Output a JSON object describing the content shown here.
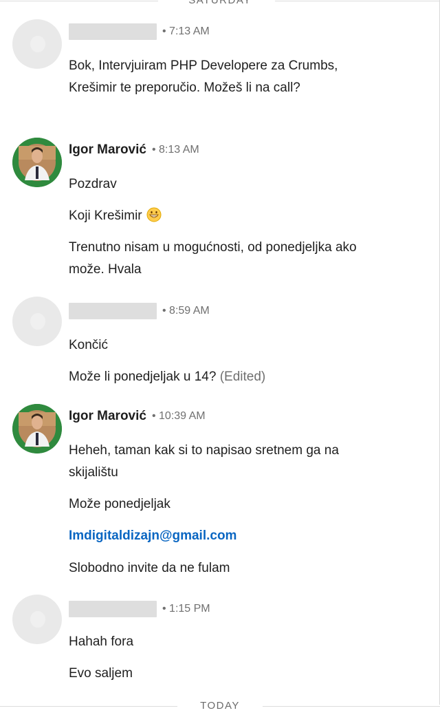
{
  "dividers": {
    "top": "SATURDAY",
    "bottom": "TODAY"
  },
  "messages": [
    {
      "time": "• 7:13 AM",
      "lines": [
        "Bok, Intervjuiram PHP Developere za Crumbs, Krešimir te preporučio. Možeš li na call?"
      ]
    },
    {
      "sender": "Igor Marović",
      "time": "• 8:13 AM",
      "lines": [
        "Pozdrav",
        "Koji Krešimir",
        "Trenutno nisam u mogućnosti, od ponedjeljka ako može. Hvala"
      ]
    },
    {
      "time": "• 8:59 AM",
      "lines": [
        "Končić",
        "Može li ponedjeljak u 14?"
      ],
      "edited": "(Edited)"
    },
    {
      "sender": "Igor Marović",
      "time": "• 10:39 AM",
      "lines": [
        "Heheh, taman kak si to napisao sretnem ga na skijalištu",
        "Može ponedjeljak",
        "Imdigitaldizajn@gmail.com",
        "Slobodno invite da ne fulam"
      ]
    },
    {
      "time": "• 1:15 PM",
      "lines": [
        "Hahah fora",
        "Evo saljem"
      ]
    }
  ],
  "icons": {
    "blank_avatar": "placeholder-avatar",
    "photo_avatar": "profile-photo",
    "emoji": "grinning-face"
  },
  "colors": {
    "link": "#0a66c2",
    "text": "#1f1f1f",
    "muted": "#707070"
  }
}
